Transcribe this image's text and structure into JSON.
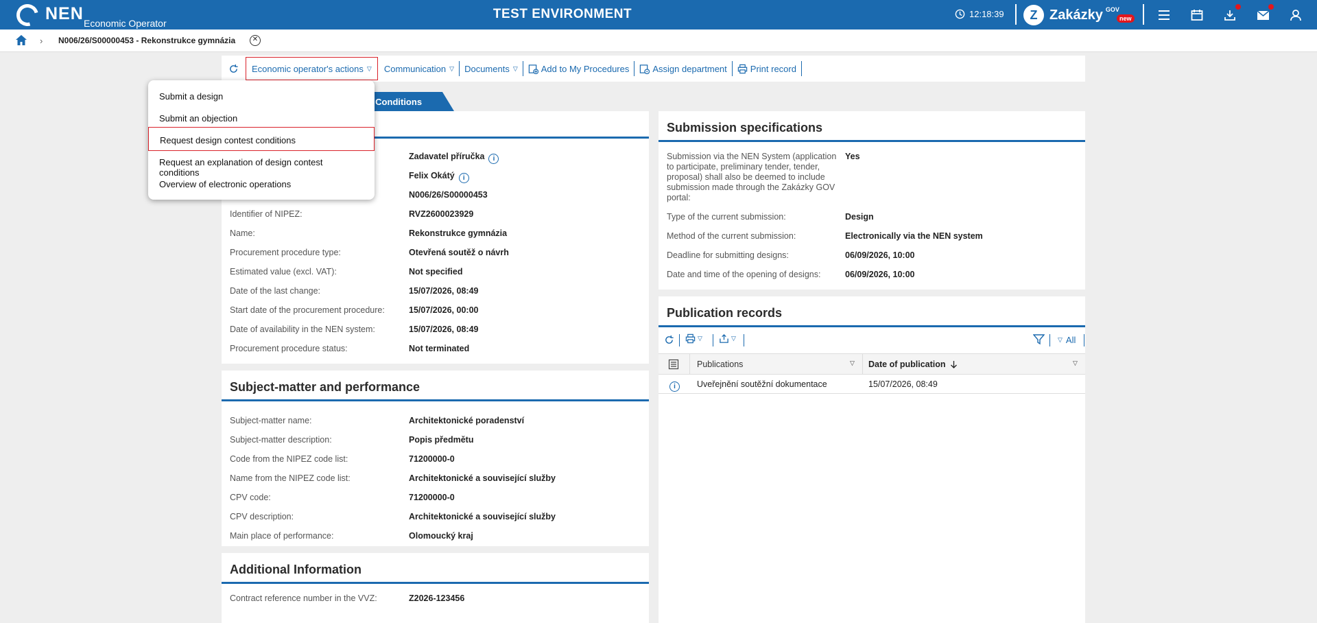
{
  "topbar": {
    "logo_text": "NEN",
    "logo_subtitle": "Economic Operator",
    "env_title": "TEST ENVIRONMENT",
    "clock": "12:18:39",
    "zakazky_label": "Zakázky",
    "zakazky_gov": "GOV",
    "zakazky_badge": "new"
  },
  "breadcrumb": {
    "title": "N006/26/S00000453 - Rekonstrukce gymnázia"
  },
  "toolbar": {
    "eo_actions": "Economic operator's actions",
    "communication": "Communication",
    "documents": "Documents",
    "add_to_my": "Add to My Procedures",
    "assign_dept": "Assign department",
    "print_record": "Print record"
  },
  "tab": {
    "label": "st Conditions"
  },
  "dropdown": {
    "items": [
      "Submit a design",
      "Submit an objection",
      "Request design contest conditions",
      "Request an explanation of design contest conditions",
      "Overview of electronic operations"
    ]
  },
  "basic": {
    "rows": [
      {
        "label": "",
        "value": "Zadavatel příručka"
      },
      {
        "label": "",
        "value": "Felix Okátý"
      },
      {
        "label": "",
        "value": "N006/26/S00000453"
      },
      {
        "label": "Identifier of NIPEZ:",
        "value": "RVZ2600023929"
      },
      {
        "label": "Name:",
        "value": "Rekonstrukce gymnázia"
      },
      {
        "label": "Procurement procedure type:",
        "value": "Otevřená soutěž o návrh"
      },
      {
        "label": "Estimated value (excl. VAT):",
        "value": "Not specified"
      },
      {
        "label": "Date of the last change:",
        "value": "15/07/2026, 08:49"
      },
      {
        "label": "Start date of the procurement procedure:",
        "value": "15/07/2026, 00:00"
      },
      {
        "label": "Date of availability in the NEN system:",
        "value": "15/07/2026, 08:49"
      },
      {
        "label": "Procurement procedure status:",
        "value": "Not terminated"
      }
    ]
  },
  "subject": {
    "title": "Subject-matter and performance",
    "rows": [
      {
        "label": "Subject-matter name:",
        "value": "Architektonické poradenství"
      },
      {
        "label": "Subject-matter description:",
        "value": "Popis předmětu"
      },
      {
        "label": "Code from the NIPEZ code list:",
        "value": "71200000-0"
      },
      {
        "label": "Name from the NIPEZ code list:",
        "value": "Architektonické a související služby"
      },
      {
        "label": "CPV code:",
        "value": "71200000-0"
      },
      {
        "label": "CPV description:",
        "value": "Architektonické a související služby"
      },
      {
        "label": "Main place of performance:",
        "value": "Olomoucký kraj"
      }
    ]
  },
  "additional": {
    "title": "Additional Information",
    "rows": [
      {
        "label": "Contract reference number in the VVZ:",
        "value": "Z2026-123456"
      }
    ]
  },
  "submission": {
    "title": "Submission specifications",
    "rows": [
      {
        "label": "Submission via the NEN System (application to participate, preliminary tender, tender, proposal) shall also be deemed to include submission made through the Zakázky GOV portal:",
        "value": "Yes"
      },
      {
        "label": "Type of the current submission:",
        "value": "Design"
      },
      {
        "label": "Method of the current submission:",
        "value": "Electronically via the NEN system"
      },
      {
        "label": "Deadline for submitting designs:",
        "value": "06/09/2026, 10:00"
      },
      {
        "label": "Date and time of the opening of designs:",
        "value": "06/09/2026, 10:00"
      }
    ]
  },
  "publication": {
    "title": "Publication records",
    "filter_all": "All",
    "columns": [
      "Publications",
      "Date of publication"
    ],
    "rows": [
      {
        "publication": "Uveřejnění soutěžní dokumentace",
        "date": "15/07/2026, 08:49"
      }
    ]
  },
  "colors": {
    "brand": "#1b6aaf",
    "highlight": "#d9222a"
  }
}
